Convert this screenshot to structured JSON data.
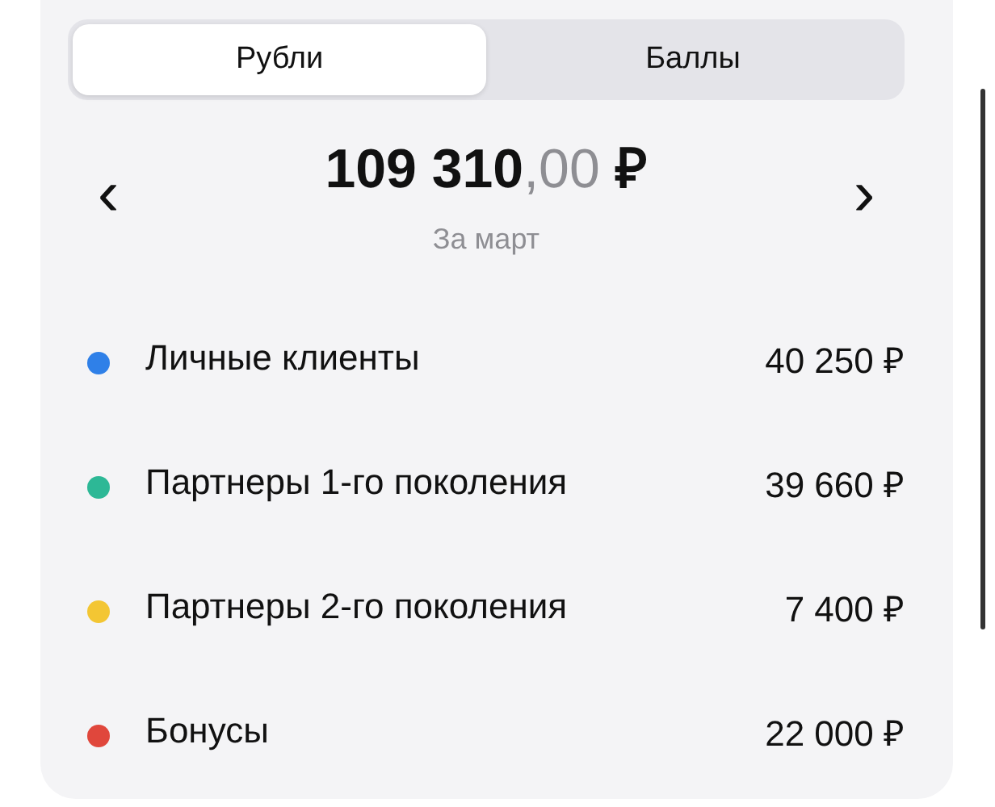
{
  "tabs": [
    {
      "label": "Рубли",
      "selected": true
    },
    {
      "label": "Баллы",
      "selected": false
    }
  ],
  "summary": {
    "prev": "‹",
    "next": "›",
    "amount_whole": "109 310",
    "amount_fraction": ",00",
    "currency": "₽",
    "period": "За март"
  },
  "items": [
    {
      "name": "Личные клиенты",
      "value": "40 250 ₽",
      "color": "#2f80e8"
    },
    {
      "name": "Партнеры 1-го поколения",
      "value": "39 660 ₽",
      "color": "#2db896"
    },
    {
      "name": "Партнеры 2-го поколения",
      "value": "7 400 ₽",
      "color": "#f3c633"
    },
    {
      "name": "Бонусы",
      "value": "22 000 ₽",
      "color": "#e0473c"
    }
  ]
}
